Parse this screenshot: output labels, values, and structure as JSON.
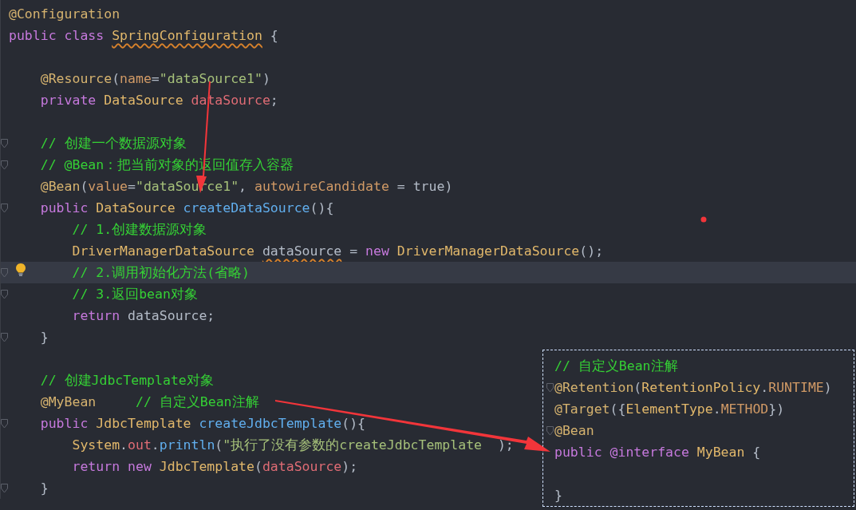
{
  "editor": {
    "lines": [
      {
        "fold": false,
        "current": false,
        "tokens": [
          {
            "kind": "annotation",
            "text": "@Configuration"
          }
        ]
      },
      {
        "fold": false,
        "current": false,
        "tokens": [
          {
            "kind": "keyword",
            "text": "public class "
          },
          {
            "kind": "type",
            "text": "SpringConfiguration",
            "warning": true
          },
          {
            "kind": "plain",
            "text": " {"
          }
        ]
      },
      {
        "fold": false,
        "current": false
      },
      {
        "fold": false,
        "current": false,
        "tokens": [
          {
            "kind": "annotation",
            "text": "    @Resource"
          },
          {
            "kind": "plain",
            "text": "("
          },
          {
            "kind": "param",
            "text": "name"
          },
          {
            "kind": "plain",
            "text": "="
          },
          {
            "kind": "string",
            "text": "\"dataSource1\""
          },
          {
            "kind": "plain",
            "text": ")"
          }
        ]
      },
      {
        "fold": false,
        "current": false,
        "tokens": [
          {
            "kind": "keyword",
            "text": "    private "
          },
          {
            "kind": "type",
            "text": "DataSource "
          },
          {
            "kind": "field",
            "text": "dataSource"
          },
          {
            "kind": "plain",
            "text": ";"
          }
        ]
      },
      {
        "fold": false,
        "current": false
      },
      {
        "fold": true,
        "current": false,
        "tokens": [
          {
            "kind": "comment",
            "text": "    // 创建一个数据源对象"
          }
        ]
      },
      {
        "fold": true,
        "current": false,
        "tokens": [
          {
            "kind": "comment",
            "text": "    // @Bean：把当前对象的返回值存入容器"
          }
        ]
      },
      {
        "fold": false,
        "current": false,
        "tokens": [
          {
            "kind": "annotation",
            "text": "    @Bean"
          },
          {
            "kind": "plain",
            "text": "("
          },
          {
            "kind": "param",
            "text": "value"
          },
          {
            "kind": "plain",
            "text": "="
          },
          {
            "kind": "string",
            "text": "\"dataSource1\""
          },
          {
            "kind": "plain",
            "text": ", "
          },
          {
            "kind": "param",
            "text": "autowireCandidate"
          },
          {
            "kind": "plain",
            "text": " = true)"
          }
        ]
      },
      {
        "fold": true,
        "current": false,
        "tokens": [
          {
            "kind": "keyword",
            "text": "    public "
          },
          {
            "kind": "type",
            "text": "DataSource "
          },
          {
            "kind": "method",
            "text": "createDataSource"
          },
          {
            "kind": "plain",
            "text": "(){"
          }
        ]
      },
      {
        "fold": false,
        "current": false,
        "tokens": [
          {
            "kind": "comment",
            "text": "        // 1.创建数据源对象"
          }
        ]
      },
      {
        "fold": false,
        "current": false,
        "tokens": [
          {
            "kind": "type",
            "text": "        DriverManagerDataSource "
          },
          {
            "kind": "plain",
            "text": "dataSource",
            "warning": true
          },
          {
            "kind": "plain",
            "text": " = "
          },
          {
            "kind": "keyword",
            "text": "new "
          },
          {
            "kind": "type",
            "text": "DriverManagerDataSource"
          },
          {
            "kind": "plain",
            "text": "();"
          }
        ]
      },
      {
        "fold": true,
        "current": true,
        "tokens": [
          {
            "kind": "comment",
            "text": "        // 2.调用初始化方法(省略)"
          }
        ]
      },
      {
        "fold": true,
        "current": false,
        "tokens": [
          {
            "kind": "comment",
            "text": "        // 3.返回bean对象"
          }
        ]
      },
      {
        "fold": false,
        "current": false,
        "tokens": [
          {
            "kind": "keyword",
            "text": "        return "
          },
          {
            "kind": "plain",
            "text": "dataSource;"
          }
        ]
      },
      {
        "fold": true,
        "current": false,
        "tokens": [
          {
            "kind": "plain",
            "text": "    }"
          }
        ]
      },
      {
        "fold": false,
        "current": false
      },
      {
        "fold": false,
        "current": false,
        "tokens": [
          {
            "kind": "comment",
            "text": "    // 创建JdbcTemplate对象"
          }
        ]
      },
      {
        "fold": false,
        "current": false,
        "tokens": [
          {
            "kind": "annotation",
            "text": "    @MyBean"
          },
          {
            "kind": "comment",
            "text": "     // 自定义Bean注解"
          }
        ]
      },
      {
        "fold": true,
        "current": false,
        "tokens": [
          {
            "kind": "keyword",
            "text": "    public "
          },
          {
            "kind": "type",
            "text": "JdbcTemplate "
          },
          {
            "kind": "method",
            "text": "createJdbcTemplate"
          },
          {
            "kind": "plain",
            "text": "(){"
          }
        ]
      },
      {
        "fold": false,
        "current": false,
        "tokens": [
          {
            "kind": "type",
            "text": "        System"
          },
          {
            "kind": "plain",
            "text": "."
          },
          {
            "kind": "field",
            "text": "out"
          },
          {
            "kind": "plain",
            "text": "."
          },
          {
            "kind": "method",
            "text": "println"
          },
          {
            "kind": "plain",
            "text": "("
          },
          {
            "kind": "string",
            "text": "\"执行了没有参数的createJdbcTemplate "
          },
          {
            "kind": "plain",
            "text": " );"
          }
        ]
      },
      {
        "fold": false,
        "current": false,
        "tokens": [
          {
            "kind": "keyword",
            "text": "        return new "
          },
          {
            "kind": "type",
            "text": "JdbcTemplate"
          },
          {
            "kind": "plain",
            "text": "("
          },
          {
            "kind": "field",
            "text": "dataSource"
          },
          {
            "kind": "plain",
            "text": ");"
          }
        ]
      },
      {
        "fold": true,
        "current": false,
        "tokens": [
          {
            "kind": "plain",
            "text": "    }"
          }
        ]
      }
    ]
  },
  "inset": {
    "lines": [
      {
        "fold": false,
        "tokens": [
          {
            "kind": "comment",
            "text": "// 自定义Bean注解"
          }
        ]
      },
      {
        "fold": true,
        "tokens": [
          {
            "kind": "annotation",
            "text": "@Retention"
          },
          {
            "kind": "plain",
            "text": "("
          },
          {
            "kind": "type",
            "text": "RetentionPolicy"
          },
          {
            "kind": "plain",
            "text": "."
          },
          {
            "kind": "param",
            "text": "RUNTIME"
          },
          {
            "kind": "plain",
            "text": ")"
          }
        ]
      },
      {
        "fold": false,
        "tokens": [
          {
            "kind": "annotation",
            "text": "@Target"
          },
          {
            "kind": "plain",
            "text": "({"
          },
          {
            "kind": "type",
            "text": "ElementType"
          },
          {
            "kind": "plain",
            "text": "."
          },
          {
            "kind": "param",
            "text": "METHOD"
          },
          {
            "kind": "plain",
            "text": "})"
          }
        ]
      },
      {
        "fold": true,
        "tokens": [
          {
            "kind": "annotation",
            "text": "@Bean"
          }
        ]
      },
      {
        "fold": false,
        "tokens": [
          {
            "kind": "keyword",
            "text": "public @interface "
          },
          {
            "kind": "type",
            "text": "MyBean"
          },
          {
            "kind": "plain",
            "text": " {"
          }
        ]
      },
      {
        "fold": false
      },
      {
        "fold": false,
        "tokens": [
          {
            "kind": "plain",
            "text": "}"
          }
        ]
      }
    ]
  }
}
